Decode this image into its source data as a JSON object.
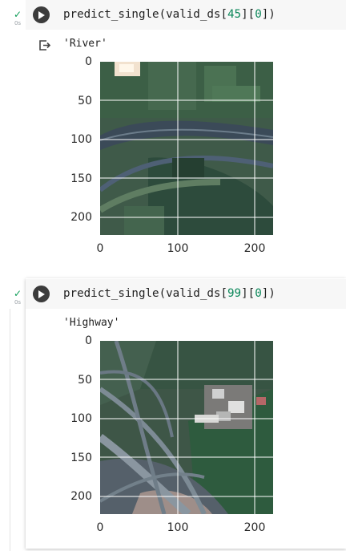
{
  "cells": [
    {
      "status_time": "0s",
      "code_prefix": "predict_single(valid_ds[",
      "code_index": "45",
      "code_mid": "][",
      "code_zero": "0",
      "code_suffix": "])",
      "output_text": "'River'",
      "plot": {
        "y_ticks": [
          "0",
          "50",
          "100",
          "150",
          "200"
        ],
        "x_ticks": [
          "0",
          "100",
          "200"
        ]
      }
    },
    {
      "status_time": "0s",
      "code_prefix": "predict_single(valid_ds[",
      "code_index": "99",
      "code_mid": "][",
      "code_zero": "0",
      "code_suffix": "])",
      "output_text": "'Highway'",
      "plot": {
        "y_ticks": [
          "0",
          "50",
          "100",
          "150",
          "200"
        ],
        "x_ticks": [
          "0",
          "100",
          "200"
        ]
      }
    }
  ],
  "icons": {
    "run": "play-icon",
    "status": "check-icon",
    "output": "output-arrow-icon"
  },
  "colors": {
    "check": "#0f9d58",
    "run_button": "#3c3c3c",
    "code_bg": "#f7f7f7",
    "number": "#098658"
  }
}
